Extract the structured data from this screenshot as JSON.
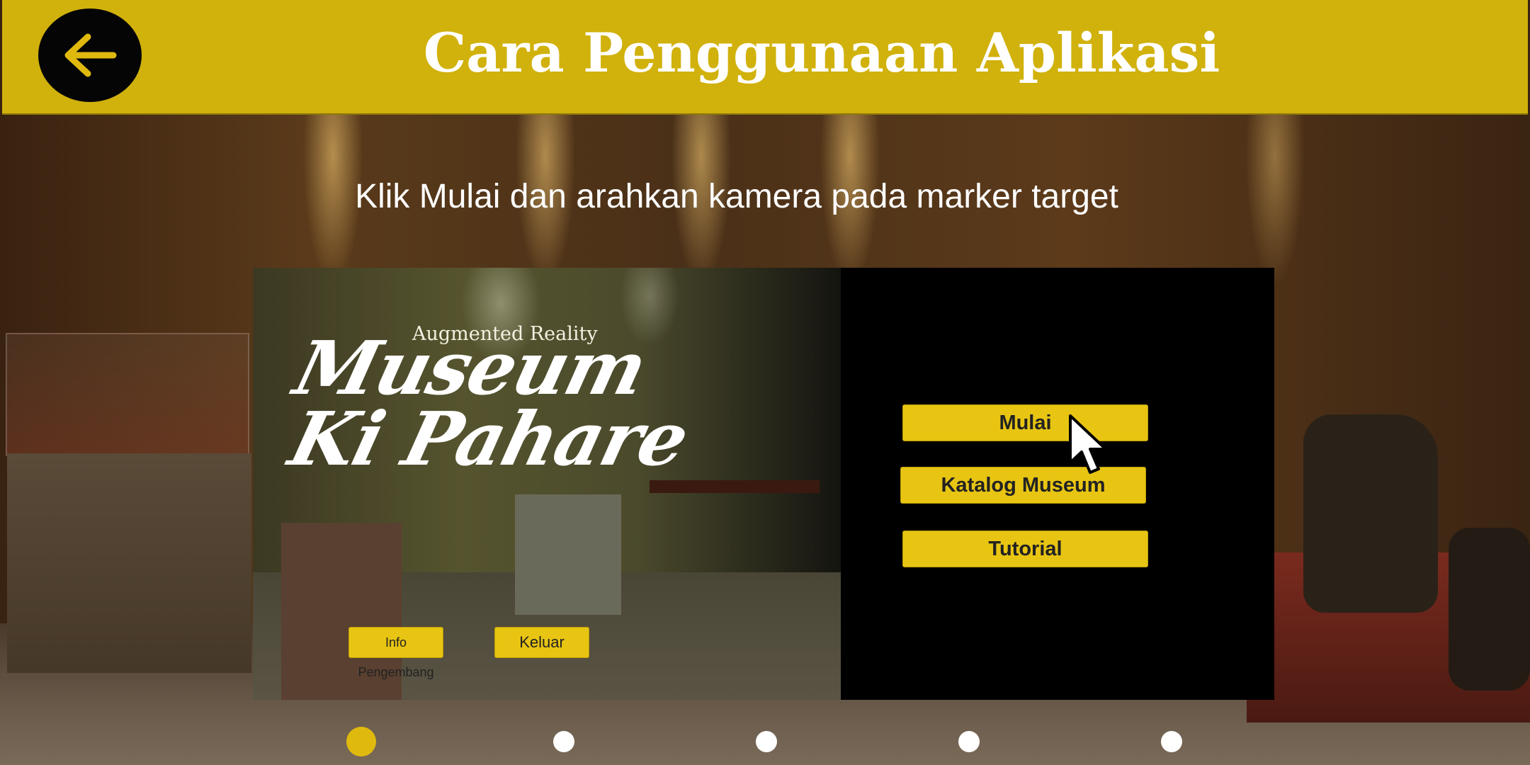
{
  "header": {
    "back_icon": "arrow-left-icon",
    "title": "Cara Penggunaan Aplikasi",
    "accent": "#d1b10c"
  },
  "instruction": "Klik Mulai dan arahkan kamera pada marker target",
  "tutorial_image": {
    "subtitle": "Augmented Reality",
    "title_line1": "Museum",
    "title_line2": "Ki Pahare",
    "buttons": {
      "start": "Mulai",
      "catalog": "Katalog Museum",
      "tutorial": "Tutorial",
      "info": "Info Pengembang",
      "exit": "Keluar"
    },
    "button_color": "#e8c512",
    "cursor_icon": "mouse-pointer-icon"
  },
  "pagination": {
    "total": 5,
    "active_index": 0,
    "active_color": "#e0b90f"
  }
}
